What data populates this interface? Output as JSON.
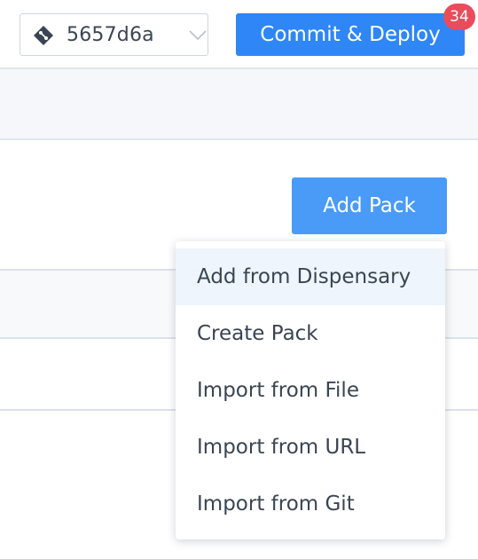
{
  "header": {
    "commit_selector": {
      "icon": "git-commit-icon",
      "hash": "5657d6a",
      "chevron_icon": "chevron-down-icon"
    },
    "deploy_button": {
      "label": "Commit & Deploy",
      "badge_count": "34"
    }
  },
  "content": {
    "add_pack_button": {
      "label": "Add Pack"
    }
  },
  "dropdown": {
    "items": [
      {
        "label": "Add from Dispensary",
        "active": true
      },
      {
        "label": "Create Pack",
        "active": false
      },
      {
        "label": "Import from File",
        "active": false
      },
      {
        "label": "Import from URL",
        "active": false
      },
      {
        "label": "Import from Git",
        "active": false
      }
    ]
  },
  "colors": {
    "primary": "#2f86f6",
    "badge": "#ea4c5b",
    "hover_bg": "#eef5fd",
    "text": "#3a4553"
  }
}
